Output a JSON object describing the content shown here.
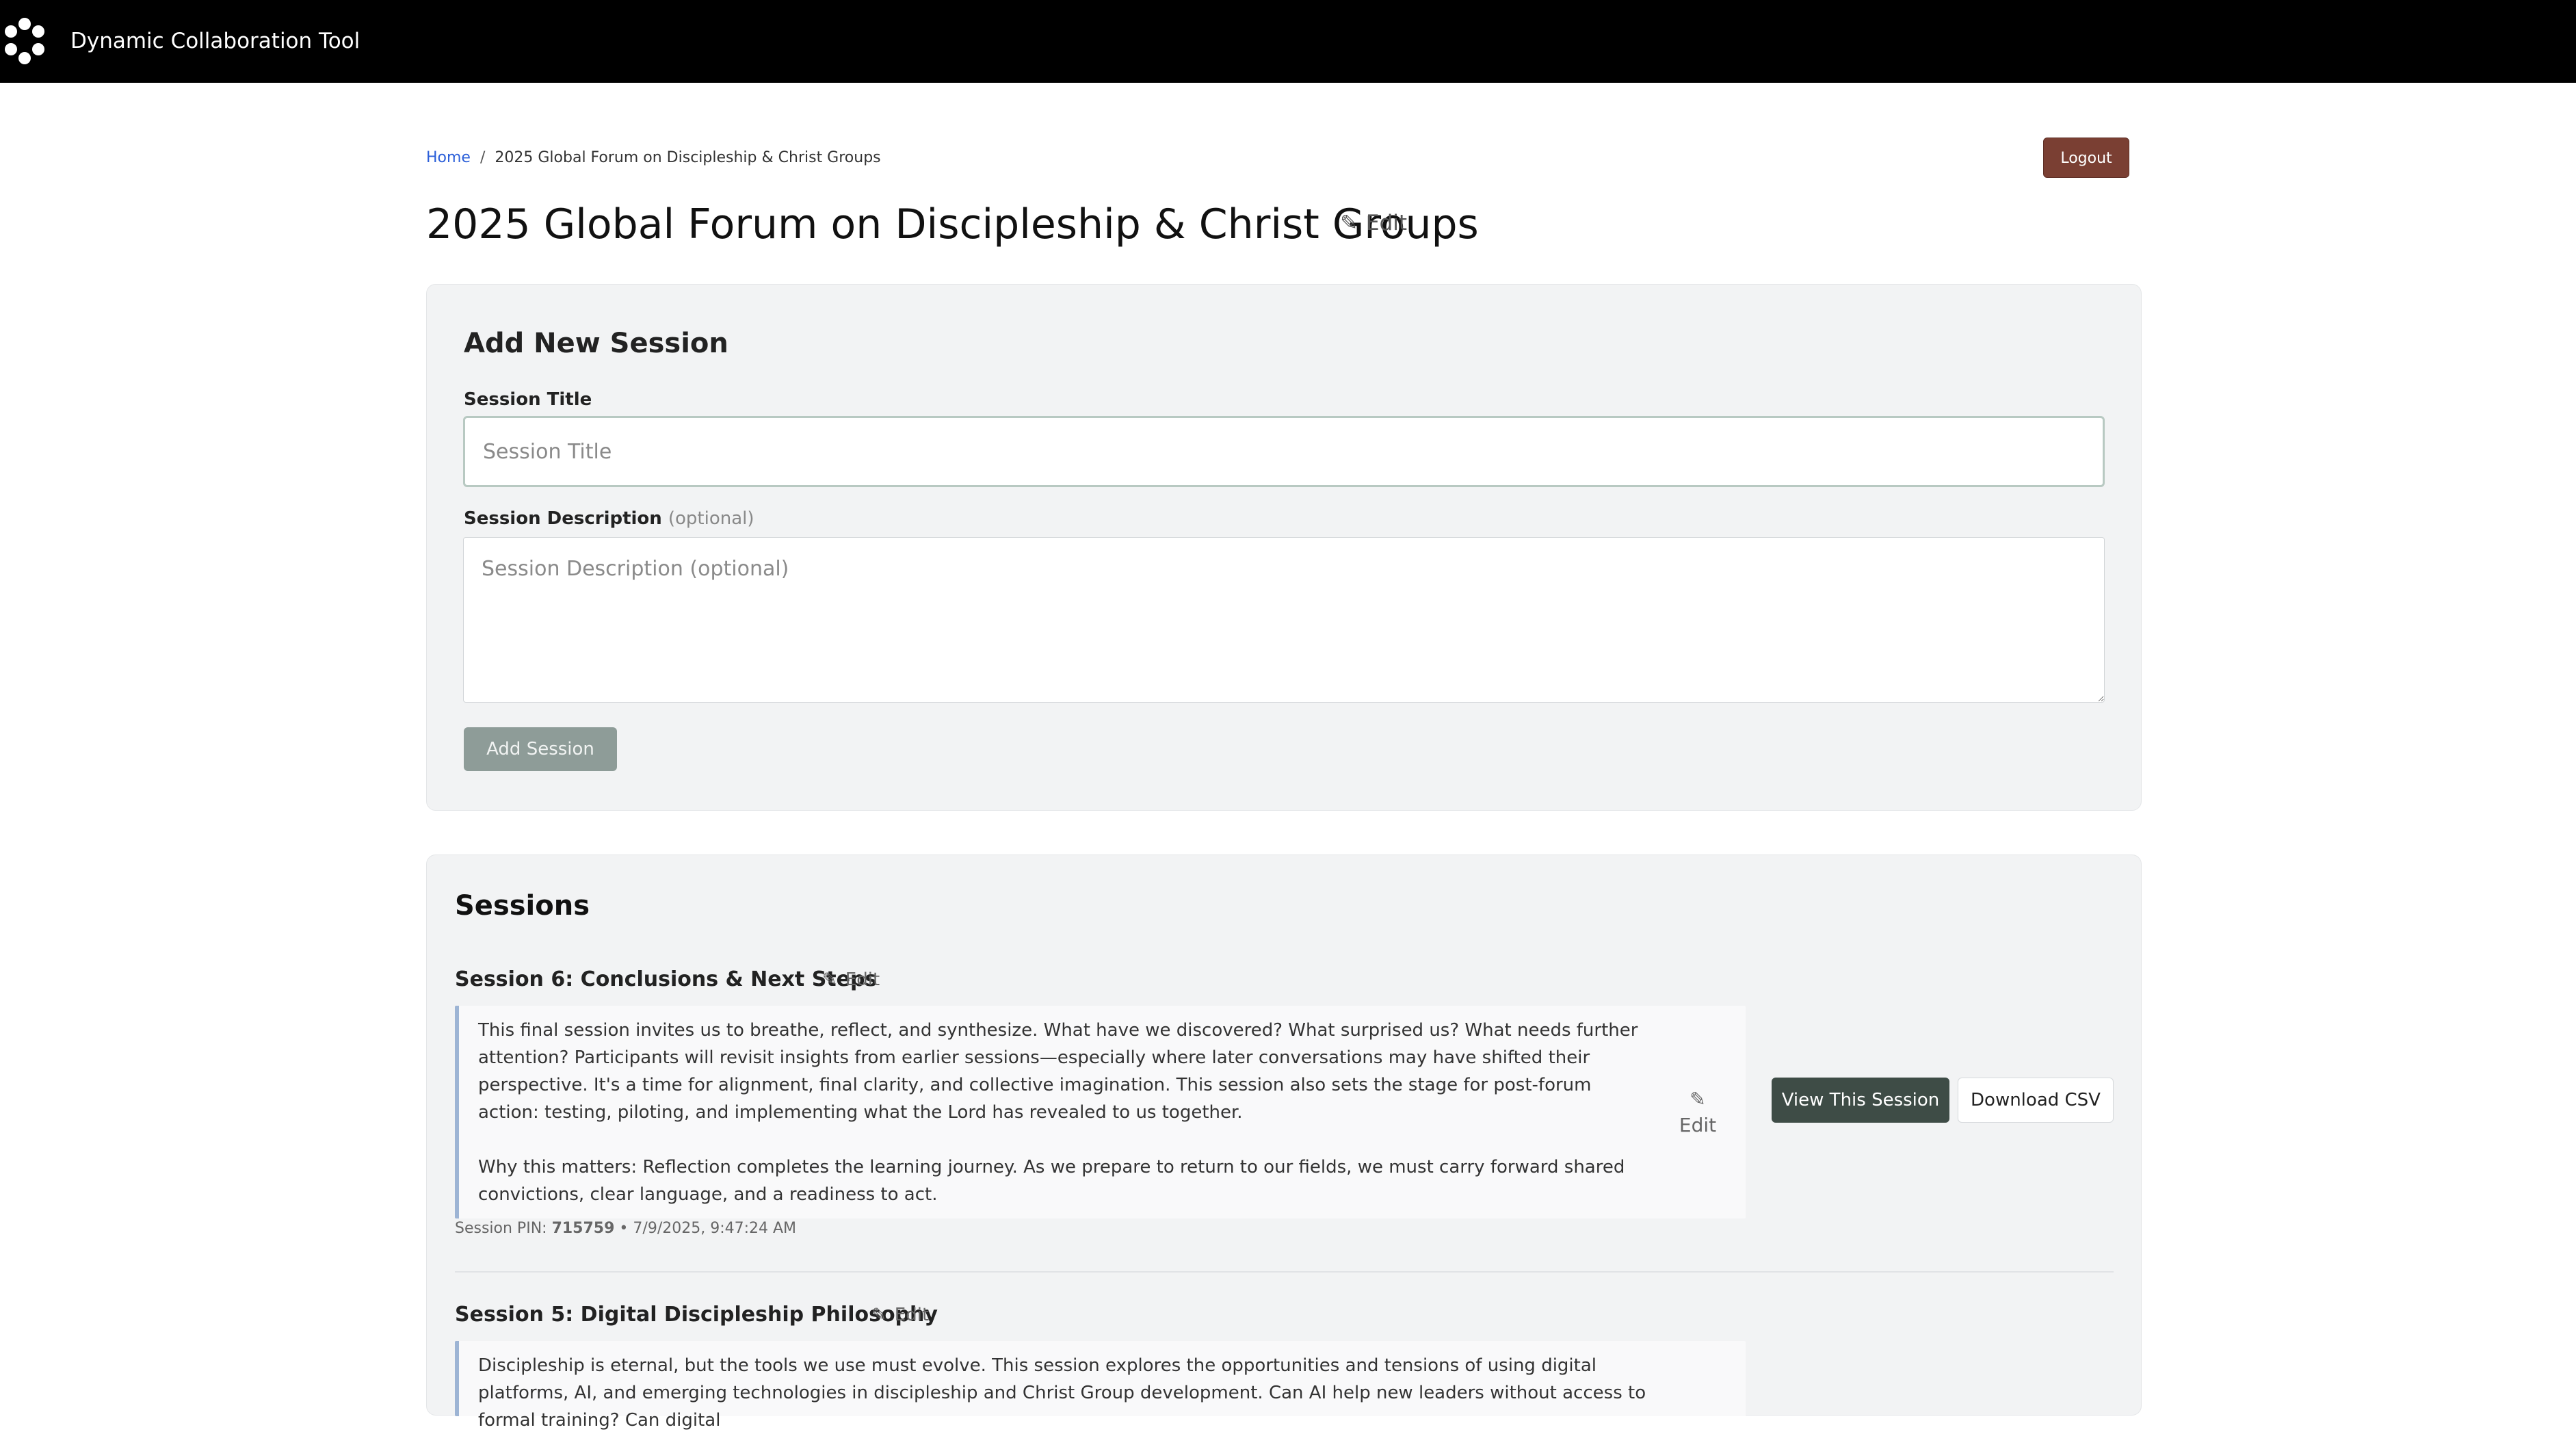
{
  "app": {
    "title": "Dynamic Collaboration Tool"
  },
  "breadcrumb": {
    "home": "Home",
    "separator": "/",
    "current": "2025 Global Forum on Discipleship & Christ Groups"
  },
  "header": {
    "logout_label": "Logout",
    "page_title": "2025 Global Forum on Discipleship & Christ Groups",
    "edit_label": "Edit"
  },
  "add_session": {
    "heading": "Add New Session",
    "title_label": "Session Title",
    "title_placeholder": "Session Title",
    "desc_label": "Session Description",
    "desc_optional": "(optional)",
    "desc_placeholder": "Session Description (optional)",
    "button_label": "Add Session"
  },
  "sessions": {
    "heading": "Sessions",
    "items": [
      {
        "title": "Session 6: Conclusions & Next Steps",
        "edit_label": "Edit",
        "description_p1": "This final session invites us to breathe, reflect, and synthesize. What have we discovered? What surprised us? What needs further attention? Participants will revisit insights from earlier sessions—especially where later conversations may have shifted their perspective. It's a time for alignment, final clarity, and collective imagination. This session also sets the stage for post-forum action: testing, piloting, and implementing what the Lord has revealed to us together.",
        "description_p2": "Why this matters: Reflection completes the learning journey. As we prepare to return to our fields, we must carry forward shared convictions, clear language, and a readiness to act.",
        "desc_edit_label": "Edit",
        "view_label": "View This Session",
        "csv_label": "Download CSV",
        "pin_label": "Session PIN:",
        "pin": "715759",
        "meta_sep": "•",
        "timestamp": "7/9/2025, 9:47:24 AM"
      },
      {
        "title": "Session 5: Digital Discipleship Philosophy",
        "edit_label": "Edit",
        "description_p1": "Discipleship is eternal, but the tools we use must evolve. This session explores the opportunities and tensions of using digital platforms, AI, and emerging technologies in discipleship and Christ Group development. Can AI help new leaders without access to formal training? Can digital"
      }
    ]
  }
}
